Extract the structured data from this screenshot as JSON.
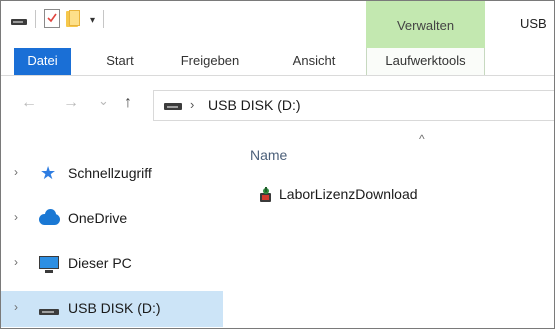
{
  "title_bar": {
    "window_title": "USB",
    "contextual_group": "Verwalten",
    "qat_dropdown": "▾"
  },
  "ribbon": {
    "tabs": [
      {
        "label": "Datei"
      },
      {
        "label": "Start"
      },
      {
        "label": "Freigeben"
      },
      {
        "label": "Ansicht"
      },
      {
        "label": "Laufwerktools"
      }
    ],
    "accent_color": "#1a6fd6",
    "contextual_color": "#c3e8b0"
  },
  "address_bar": {
    "back": "←",
    "forward": "→",
    "recent": "⌄",
    "up": "↑",
    "chevron": "›",
    "path": "USB DISK (D:)"
  },
  "nav_pane": {
    "expand_glyph": "›",
    "items": [
      {
        "label": "Schnellzugriff",
        "icon": "star-icon"
      },
      {
        "label": "OneDrive",
        "icon": "cloud-icon"
      },
      {
        "label": "Dieser PC",
        "icon": "monitor-icon"
      },
      {
        "label": "USB DISK (D:)",
        "icon": "usb-drive-icon",
        "selected": true
      }
    ]
  },
  "content": {
    "sort_caret": "^",
    "column_header": "Name",
    "files": [
      {
        "name": "LaborLizenzDownload",
        "icon": "installer-app-icon"
      }
    ]
  }
}
